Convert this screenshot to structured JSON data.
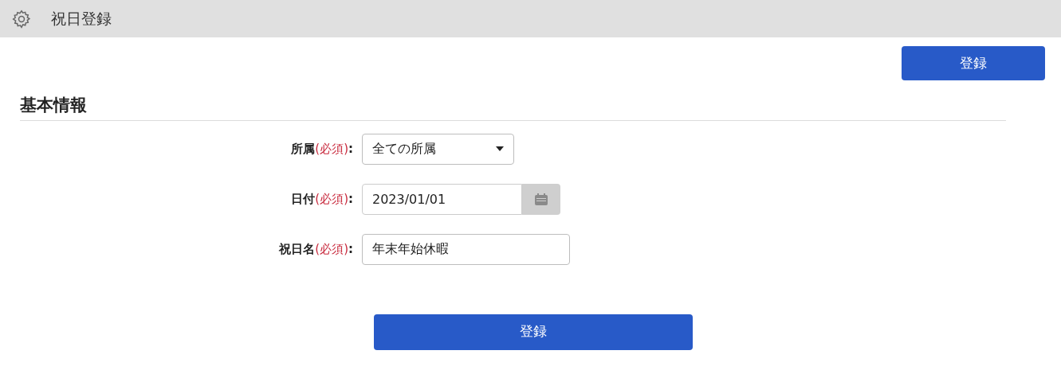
{
  "header": {
    "title": "祝日登録"
  },
  "top_button": "登録",
  "section": {
    "title": "基本情報"
  },
  "fields": [
    {
      "kind": "select",
      "label": "所属",
      "required_note": "(必須)",
      "separator": ":",
      "value": "全ての所属"
    },
    {
      "kind": "date",
      "label": "日付",
      "required_note": "(必須)",
      "separator": ":",
      "value": "2023/01/01"
    },
    {
      "kind": "text",
      "label": "祝日名",
      "required_note": "(必須)",
      "separator": ":",
      "value": "年末年始休暇"
    }
  ],
  "bottom_button": "登録"
}
